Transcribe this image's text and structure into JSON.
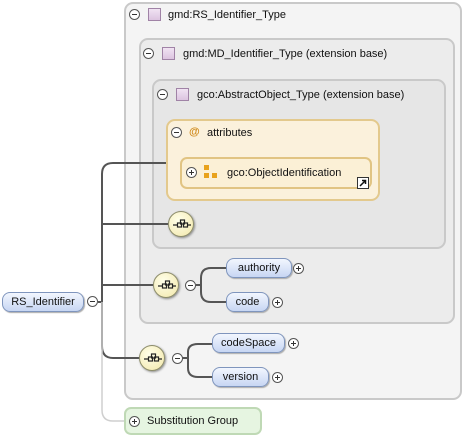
{
  "root": {
    "label": "RS_Identifier"
  },
  "types": {
    "outer": {
      "label": "gmd:RS_Identifier_Type"
    },
    "middle": {
      "label": "gmd:MD_Identifier_Type (extension base)"
    },
    "inner": {
      "label": "gco:AbstractObject_Type (extension base)"
    }
  },
  "attributes": {
    "label": "attributes",
    "at_symbol": "@",
    "group": {
      "label": "gco:ObjectIdentification"
    }
  },
  "elements": [
    {
      "label": "authority"
    },
    {
      "label": "code"
    },
    {
      "label": "codeSpace"
    },
    {
      "label": "version"
    }
  ],
  "substitution": {
    "label": "Substitution Group"
  },
  "colors": {
    "element_fill": "#c7d6f3",
    "attribute_fill": "#fbf1dc",
    "substitution_fill": "#e6f5e1",
    "connector": "#555555"
  },
  "icons": {
    "type": "type-icon",
    "sequence": "sequence-compositor-icon",
    "attribute_group": "attribute-group-icon",
    "shortcut": "shortcut-arrow-icon"
  }
}
